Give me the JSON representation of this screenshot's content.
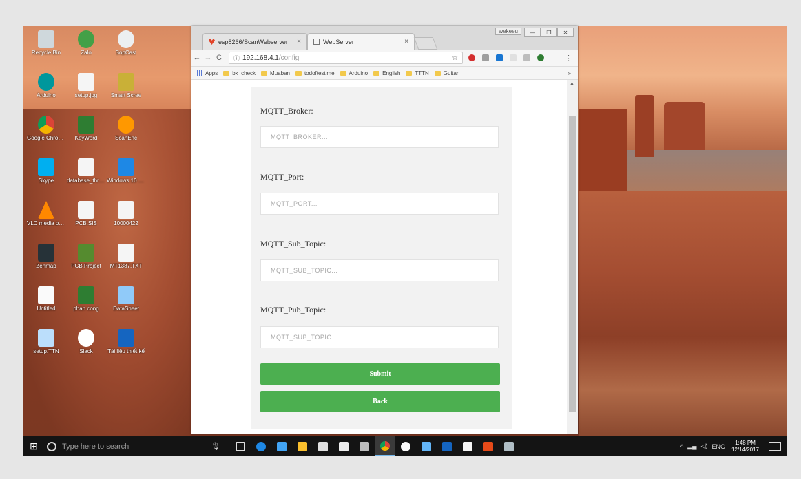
{
  "browser": {
    "tabs": [
      {
        "label": "esp8266/ScanWebserver",
        "active": false
      },
      {
        "label": "WebServer",
        "active": true
      }
    ],
    "window_user": "wekeeu",
    "url_host": "192.168.4.1",
    "url_path": "/config",
    "bookmarks": [
      "Apps",
      "bk_check",
      "Muaban",
      "todoftestime",
      "Arduino",
      "English",
      "TTTN",
      "Guitar"
    ],
    "bookmarks_more": "»"
  },
  "form": {
    "fields": [
      {
        "label": "MQTT_Broker:",
        "placeholder": "MQTT_BROKER..."
      },
      {
        "label": "MQTT_Port:",
        "placeholder": "MQTT_PORT..."
      },
      {
        "label": "MQTT_Sub_Topic:",
        "placeholder": "MQTT_SUB_TOPIC..."
      },
      {
        "label": "MQTT_Pub_Topic:",
        "placeholder": "MQTT_SUB_TOPIC..."
      }
    ],
    "submit_label": "Submit",
    "back_label": "Back"
  },
  "desktop": {
    "icons": [
      "Recycle Bin",
      "Zalo",
      "SopCast",
      "Arduino",
      "setup.jpg",
      "Smart Scree",
      "Google Chrome",
      "KeyWord",
      "ScanEnc",
      "Skype",
      "database_thread",
      "Windows 10 Upgrade",
      "VLC media player",
      "PCB.SIS",
      "10000422",
      "Zenmap",
      "PCB.Project",
      "MT1387.TXT",
      "Untitled",
      "phan cong",
      "DataSheet",
      "setup.TTN",
      "Slack",
      "Tài liệu thiết kế"
    ]
  },
  "taskbar": {
    "search_placeholder": "Type here to search",
    "lang": "ENG",
    "time": "1:48 PM",
    "date": "12/14/2017"
  },
  "colors": {
    "button_green": "#4caf50",
    "taskbar": "#141414"
  }
}
